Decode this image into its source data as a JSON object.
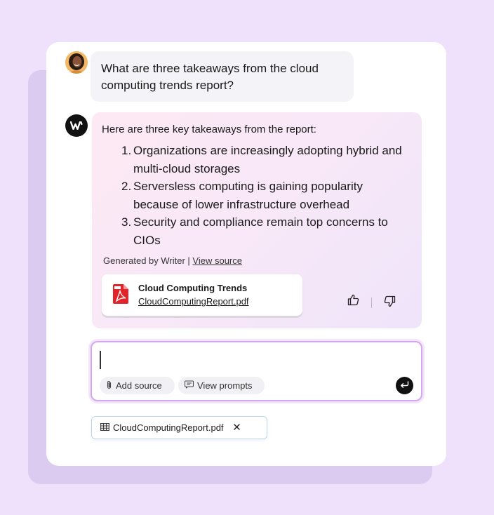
{
  "user_message": {
    "text": "What are three takeaways from the cloud computing trends report?",
    "avatar_icon": "user-avatar"
  },
  "assistant": {
    "logo_icon": "writer-logo",
    "intro": "Here are three key takeaways from the report:",
    "takeaways": [
      {
        "num": "1.",
        "text": "Organizations are increasingly adopting hybrid and multi-cloud storages"
      },
      {
        "num": "2.",
        "text": "Serversless computing is gaining popularity because of lower infrastructure overhead"
      },
      {
        "num": "3.",
        "text": "Security and compliance remain top concerns to CIOs"
      }
    ],
    "generated_prefix": "Generated by Writer | ",
    "view_source": "View source",
    "source_file": {
      "title": "Cloud Computing Trends",
      "filename": "CloudComputingReport.pdf",
      "icon": "pdf-icon"
    },
    "feedback": {
      "up_icon": "thumbs-up-icon",
      "down_icon": "thumbs-down-icon"
    }
  },
  "composer": {
    "value": "",
    "add_source": "Add source",
    "view_prompts": "View prompts",
    "send_icon": "enter-icon"
  },
  "attachment": {
    "name": "CloudComputingReport.pdf",
    "icon": "table-icon",
    "close_icon": "close-icon"
  },
  "colors": {
    "page_bg": "#efe0fc",
    "composer_border": "#d4a8f0",
    "pdf_red": "#e0252a"
  }
}
